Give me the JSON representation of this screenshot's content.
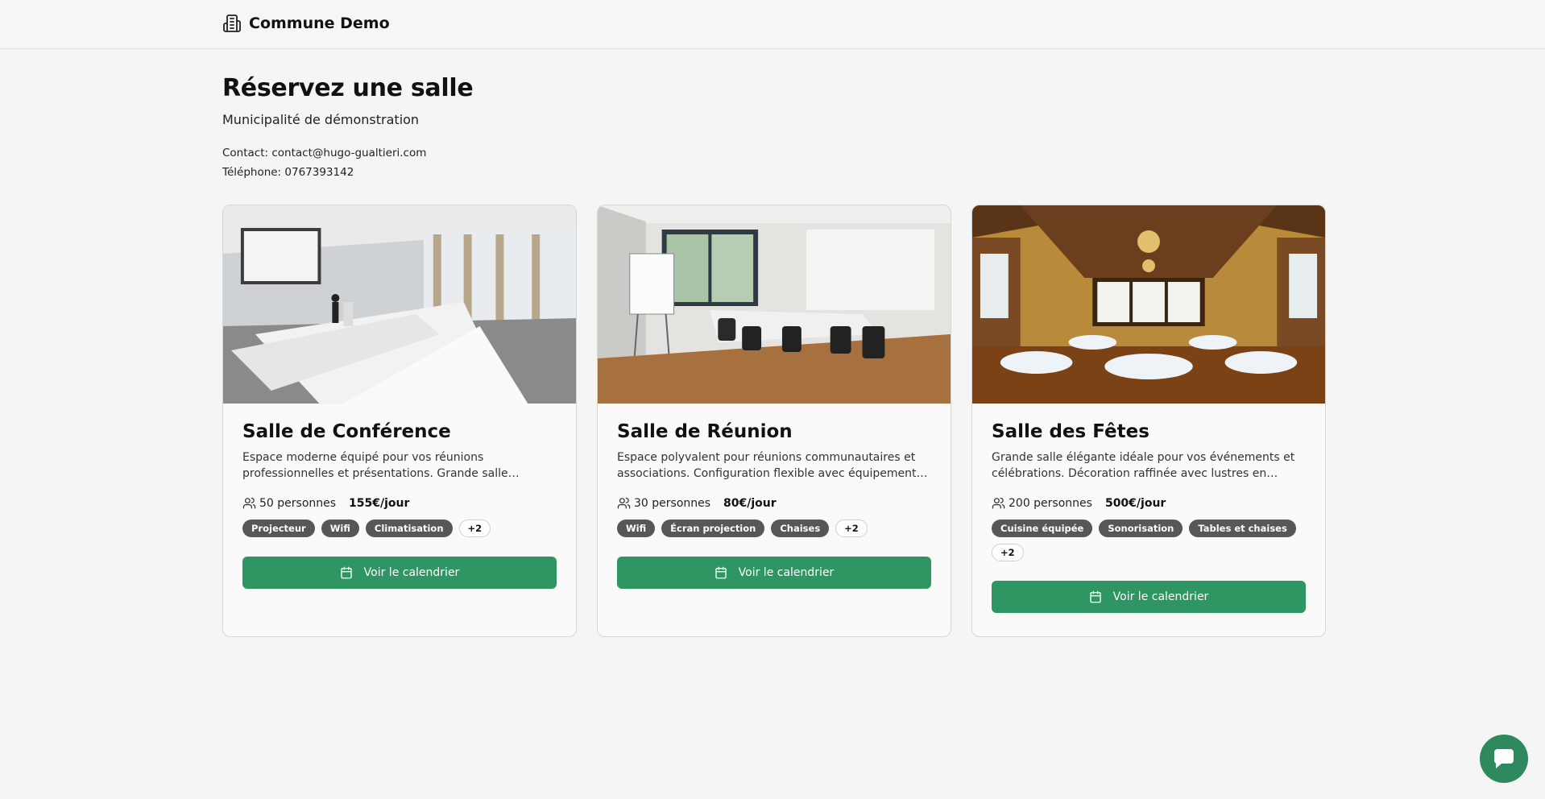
{
  "header": {
    "brand": "Commune Demo",
    "brand_icon": "building-icon"
  },
  "main": {
    "title": "Réservez une salle",
    "subtitle": "Municipalité de démonstration",
    "contact": "Contact: contact@hugo-gualtieri.com",
    "phone": "Téléphone: 0767393142"
  },
  "rooms": [
    {
      "name": "Salle de Conférence",
      "description": "Espace moderne équipé pour vos réunions professionnelles et présentations. Grande salle lumineuse avec vue sur le jardin.",
      "capacity": "50 personnes",
      "price": "155€/jour",
      "tags": [
        "Projecteur",
        "Wifi",
        "Climatisation"
      ],
      "more": "+2",
      "button": "Voir le calendrier"
    },
    {
      "name": "Salle de Réunion",
      "description": "Espace polyvalent pour réunions communautaires et associations. Configuration flexible avec équipement de présentation.",
      "capacity": "30 personnes",
      "price": "80€/jour",
      "tags": [
        "Wifi",
        "Écran projection",
        "Chaises"
      ],
      "more": "+2",
      "button": "Voir le calendrier"
    },
    {
      "name": "Salle des Fêtes",
      "description": "Grande salle élégante idéale pour vos événements et célébrations. Décoration raffinée avec lustres en cristal.",
      "capacity": "200 personnes",
      "price": "500€/jour",
      "tags": [
        "Cuisine équipée",
        "Sonorisation",
        "Tables et chaises"
      ],
      "more": "+2",
      "button": "Voir le calendrier"
    }
  ],
  "chat": {
    "icon": "chat-bubble-icon"
  },
  "colors": {
    "accent": "#2e9563",
    "tag_bg": "#575757",
    "background": "#f5f5f5"
  }
}
